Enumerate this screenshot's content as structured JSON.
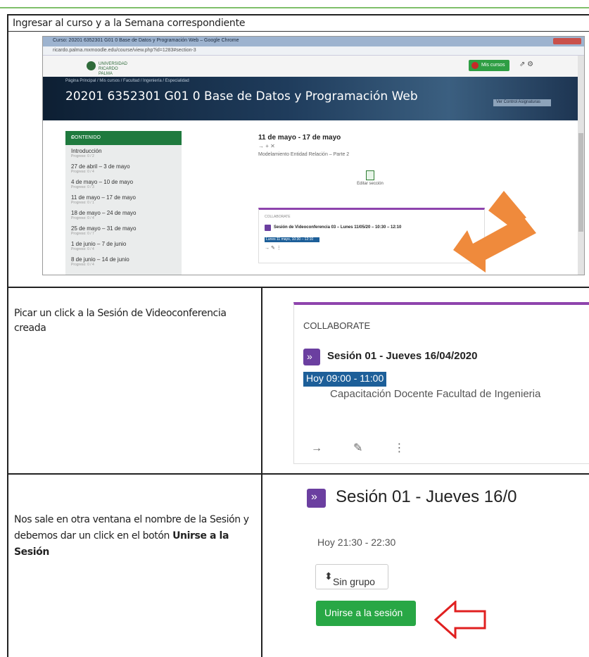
{
  "row1": {
    "heading": "Ingresar al curso y a la Semana correspondiente",
    "browser": {
      "tab_title": "Curso: 20201 6352301 G01 0 Base de Datos y Programación Web – Google Chrome",
      "url": "ricardo.palma.mxmoodle.edu/course/view.php?id=1283#section-3",
      "logo_text": "UNIVERSIDAD RICARDO PALMA",
      "my_courses": "Mis cursos",
      "breadcrumbs": "Página Principal / Mis cursos / Facultad / Ingeniería / Especialidad",
      "course_title": "20201 6352301 G01 0 Base de Datos y Programación Web",
      "view_button": "Ver Control Asignaturas",
      "nav_header": "CONTENIDO",
      "nav_items": [
        {
          "label": "Introducción",
          "sub": "Progreso: 0 / 2"
        },
        {
          "label": "27 de abril – 3 de mayo",
          "sub": "Progreso: 0 / 4"
        },
        {
          "label": "4 de mayo – 10 de mayo",
          "sub": "Progreso: 0 / 3"
        },
        {
          "label": "11 de mayo – 17 de mayo",
          "sub": "Progreso: 0 / 1"
        },
        {
          "label": "18 de mayo – 24 de mayo",
          "sub": "Progreso: 0 / 4"
        },
        {
          "label": "25 de mayo – 31 de mayo",
          "sub": "Progreso: 0 / 7"
        },
        {
          "label": "1 de junio – 7 de junio",
          "sub": "Progreso: 0 / 4"
        },
        {
          "label": "8 de junio – 14 de junio",
          "sub": "Progreso: 0 / 4"
        }
      ],
      "week_title": "11 de mayo - 17 de mayo",
      "week_icons": "→  +  ✕",
      "week_desc": "Modelamiento Entidad Relación – Parte 2",
      "edit_section": "Editar sección",
      "collab_header": "COLLABORATE",
      "collab_title": "Sesión de Videoconferencia 03 – Lunes 11/05/20 – 10:30 – 12:10",
      "collab_time": "Lunes 11 mayo, 10:30 – 12:10",
      "collab_actions": "→    ✎    ⋮"
    }
  },
  "row2": {
    "instruction": "Picar un click a la Sesión de Videoconferencia creada",
    "card": {
      "kicker": "COLLABORATE",
      "title": "Sesión 01 - Jueves 16/04/2020",
      "time": "Hoy 09:00 - 11:00",
      "description": "Capacitación Docente Facultad de Ingenieria"
    }
  },
  "row3": {
    "instruction_start": "Nos sale en otra ventana el nombre de la Sesión y debemos dar un click en el botón ",
    "instruction_bold": "Unirse a la Sesión",
    "session_title": "Sesión 01 - Jueves 16/0",
    "session_time": "Hoy 21:30 - 22:30",
    "group_select": "Sin grupo",
    "join_button": "Unirse a la sesión"
  },
  "colors": {
    "accent_purple": "#6b3fa0",
    "card_border": "#8e44ad",
    "time_highlight": "#1d5f99",
    "join_green": "#28a745",
    "arrow_orange": "#ef8a3c",
    "arrow_red": "#e02020"
  }
}
